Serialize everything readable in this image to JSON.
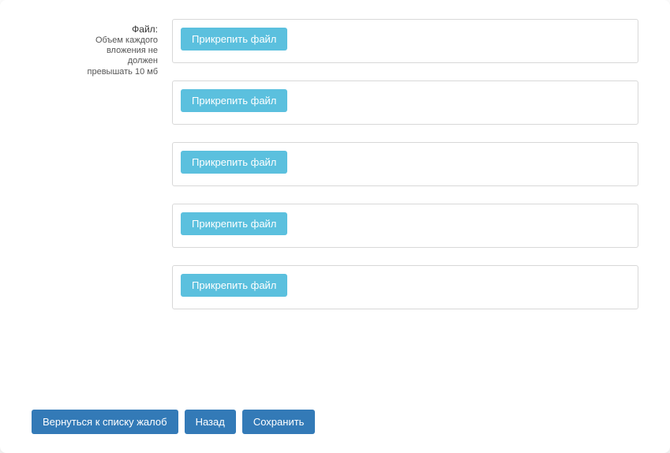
{
  "file_section": {
    "label_title": "Файл:",
    "label_sub_line1": "Объем каждого",
    "label_sub_line2": "вложения не",
    "label_sub_line3": "должен",
    "label_sub_line4": "превышать 10 мб",
    "slots": [
      {
        "attach_label": "Прикрепить файл"
      },
      {
        "attach_label": "Прикрепить файл"
      },
      {
        "attach_label": "Прикрепить файл"
      },
      {
        "attach_label": "Прикрепить файл"
      },
      {
        "attach_label": "Прикрепить файл"
      }
    ]
  },
  "footer": {
    "back_to_list": "Вернуться к списку жалоб",
    "back": "Назад",
    "save": "Сохранить"
  }
}
